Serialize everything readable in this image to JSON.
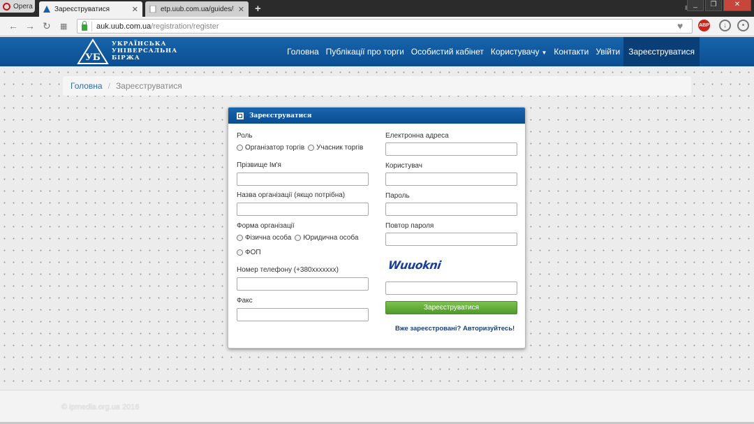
{
  "browser": {
    "opera_label": "Opera",
    "tabs": [
      {
        "title": "Зареєструватися",
        "active": true
      },
      {
        "title": "etp.uub.com.ua/guides/Ker",
        "active": false
      }
    ],
    "new_tab": "+",
    "address": {
      "host": "auk.uub.com.ua",
      "path": "/registration/register"
    },
    "abp_label": "ABP",
    "window_controls": [
      "minimize-icon",
      "restore-icon",
      "close-icon"
    ]
  },
  "site": {
    "logo_lines": [
      "УКРАЇНСЬКА",
      "УНІВЕРСАЛЬНА",
      "БІРЖА"
    ],
    "nav": [
      {
        "label": "Головна"
      },
      {
        "label": "Публікації про торги"
      },
      {
        "label": "Особистий кабінет"
      },
      {
        "label": "Користувачу",
        "dropdown": true
      },
      {
        "label": "Контакти"
      },
      {
        "label": "Увійти"
      },
      {
        "label": "Зареєструватися",
        "active": true
      }
    ],
    "colors": {
      "header": "#0b4e92",
      "accent": "#2a6ead",
      "button": "#5fa935"
    }
  },
  "breadcrumb": {
    "home": "Головна",
    "separator": "/",
    "current": "Зареєструватися"
  },
  "form": {
    "title": "Зареєструватися",
    "role_label": "Роль",
    "role_options": [
      "Організатор торгів",
      "Учасник торгів"
    ],
    "name_label": "Прізвище Ім'я",
    "org_label": "Назва організації (якщо потрібна)",
    "org_form_label": "Форма організації",
    "org_form_options": [
      "Фізична особа",
      "Юридична особа",
      "ФОП"
    ],
    "phone_label": "Номер телефону (+380xxxxxxx)",
    "fax_label": "Факс",
    "email_label": "Електронна адреса",
    "user_label": "Користувач",
    "password_label": "Пароль",
    "password_repeat_label": "Повтор пароля",
    "captcha_text": "Wuuokni",
    "submit_label": "Зареєструватися",
    "login_link": "Вже зареєстровані? Авторизуйтесь!"
  },
  "footer": {
    "text": "© ipmedia.org.ua 2016"
  }
}
